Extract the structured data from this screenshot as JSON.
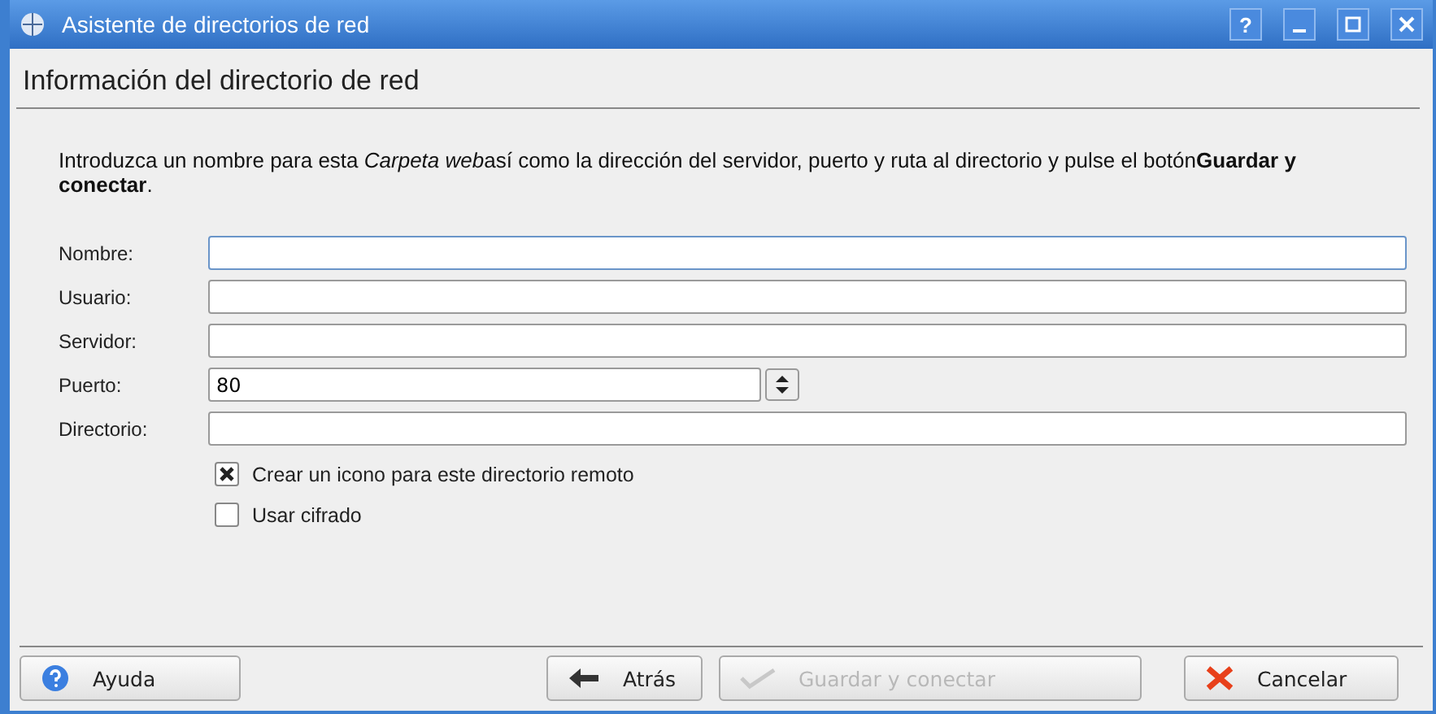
{
  "window": {
    "title": "Asistente de directorios de red",
    "controls": [
      {
        "kind": "help",
        "label": "?"
      },
      {
        "kind": "minimize"
      },
      {
        "kind": "maximize"
      },
      {
        "kind": "close"
      }
    ]
  },
  "heading": "Información del directorio de red",
  "intro": [
    {
      "text": "Introduzca un nombre para esta ",
      "kind": "plain"
    },
    {
      "text": "Carpeta web",
      "kind": "emphasis"
    },
    {
      "text": "así como la dirección del servidor, puerto y ruta al directorio y pulse el botón",
      "kind": "plain"
    },
    {
      "text": "Guardar y conectar",
      "kind": "strong"
    },
    {
      "text": ".",
      "kind": "plain"
    }
  ],
  "fields": [
    {
      "label": "Nombre:",
      "kind": "text",
      "focused": true
    },
    {
      "label": "Usuario:",
      "kind": "text",
      "focused": false
    },
    {
      "label": "Servidor:",
      "kind": "text",
      "focused": false
    },
    {
      "label": "Puerto:",
      "kind": "spin",
      "value": "80",
      "focused": false
    },
    {
      "label": "Directorio:",
      "kind": "text",
      "focused": false
    }
  ],
  "options": [
    {
      "label": "Crear un icono para este directorio remoto",
      "checked": true
    },
    {
      "label": "Usar cifrado",
      "checked": false
    }
  ],
  "buttons": [
    {
      "label": "Ayuda",
      "kind": "help",
      "disabled": false
    },
    {
      "label": "Atrás",
      "kind": "back",
      "disabled": false
    },
    {
      "label": "Guardar y conectar",
      "kind": "finish",
      "disabled": true
    },
    {
      "label": "Cancelar",
      "kind": "cancel",
      "disabled": false
    }
  ]
}
